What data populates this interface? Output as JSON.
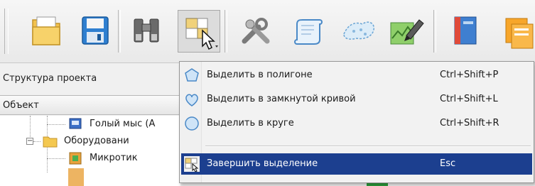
{
  "toolbar": {
    "buttons": [
      {
        "name": "new-document-button",
        "icon": "document-folder-icon"
      },
      {
        "name": "save-button",
        "icon": "floppy-disk-icon"
      },
      {
        "name": "find-button",
        "icon": "binoculars-icon"
      },
      {
        "name": "selection-tool-button",
        "icon": "select-cursor-icon",
        "pressed": true
      },
      {
        "name": "tools-button",
        "icon": "wrench-tools-icon"
      },
      {
        "name": "line-tool-button",
        "icon": "curve-line-icon"
      },
      {
        "name": "area-tool-button",
        "icon": "map-area-icon"
      },
      {
        "name": "map-edit-button",
        "icon": "map-pen-icon"
      },
      {
        "name": "book-button",
        "icon": "book-icon"
      },
      {
        "name": "pages-button",
        "icon": "pages-icon"
      }
    ]
  },
  "panel": {
    "title": "Структура проекта",
    "column_header": "Объект",
    "tree": [
      {
        "label": "Голый мыс (А",
        "icon": "node-device-icon",
        "level": 2
      },
      {
        "label": "Оборудовани",
        "icon": "folder-icon",
        "level": 1,
        "expanded": true
      },
      {
        "label": "Микротик",
        "icon": "node-router-icon",
        "level": 2
      }
    ]
  },
  "menu": {
    "items": [
      {
        "label": "Выделить в полигоне",
        "shortcut": "Ctrl+Shift+P",
        "icon": "polygon-select-icon"
      },
      {
        "label": "Выделить в замкнутой кривой",
        "shortcut": "Ctrl+Shift+L",
        "icon": "curve-select-icon"
      },
      {
        "label": "Выделить в круге",
        "shortcut": "Ctrl+Shift+R",
        "icon": "circle-select-icon"
      },
      {
        "label": "Завершить выделение",
        "shortcut": "Esc",
        "icon": "finish-select-icon",
        "selected": true
      }
    ]
  },
  "colors": {
    "menu_highlight": "#1c3f8f",
    "menu_background": "#f2f2f2"
  }
}
